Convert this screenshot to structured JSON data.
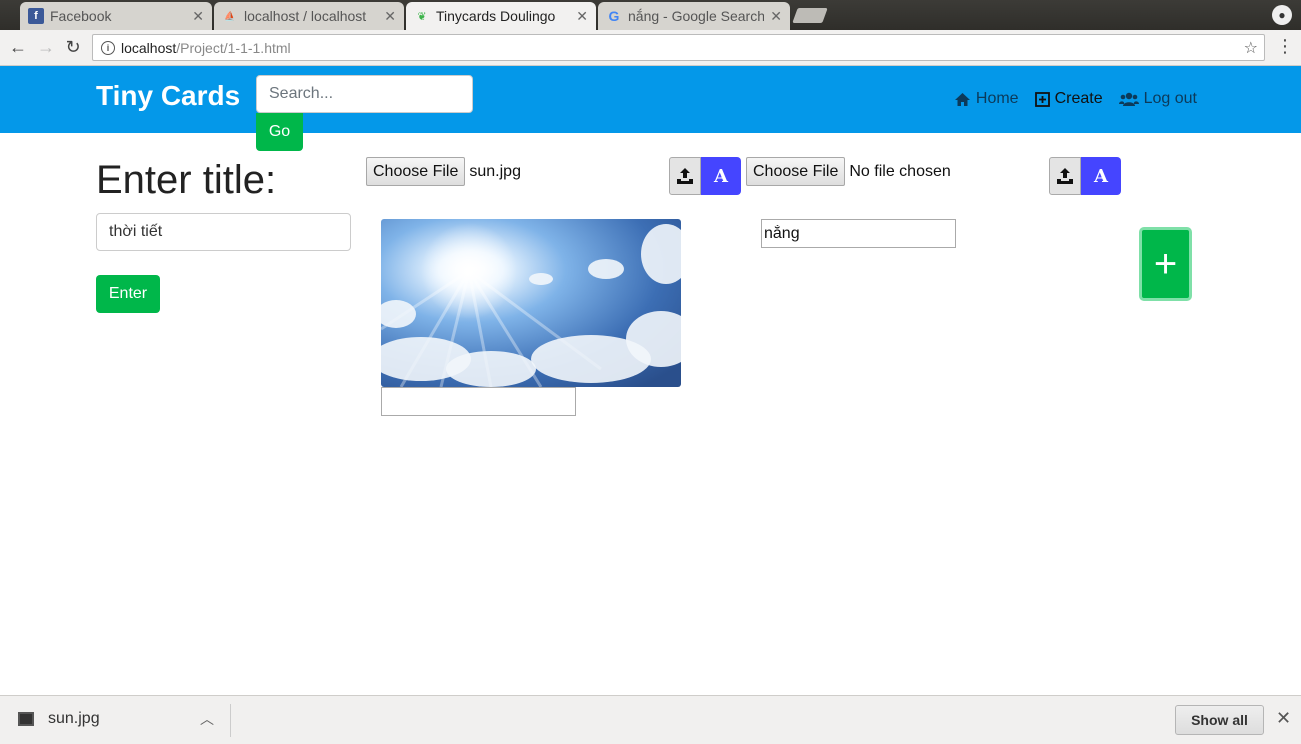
{
  "browser": {
    "tabs": [
      {
        "title": "Facebook",
        "icon": "facebook-icon",
        "active": false
      },
      {
        "title": "localhost / localhost",
        "icon": "phpmyadmin-icon",
        "active": false
      },
      {
        "title": "Tinycards Doulingo",
        "icon": "tinycards-icon",
        "active": true
      },
      {
        "title": "nắng - Google Search",
        "icon": "google-icon",
        "active": false
      }
    ],
    "url_host": "localhost",
    "url_path": "/Project/1-1-1.html"
  },
  "navbar": {
    "brand": "Tiny Cards",
    "search_placeholder": "Search...",
    "go_label": "Go",
    "links": {
      "home": "Home",
      "create": "Create",
      "logout": "Log out"
    },
    "bg_color": "#0498e9"
  },
  "form": {
    "title_heading": "Enter title:",
    "title_value": "thời tiết",
    "enter_label": "Enter"
  },
  "card1": {
    "choose_file_label": "Choose File",
    "file_name": "sun.jpg",
    "a_button_label": "A",
    "image_alt": "sky with sun",
    "caption_value": ""
  },
  "card2": {
    "choose_file_label": "Choose File",
    "file_name": "No file chosen",
    "a_button_label": "A",
    "caption_value": "nắng"
  },
  "add_button_label": "+",
  "downloads": {
    "file_name": "sun.jpg",
    "show_all_label": "Show all"
  },
  "colors": {
    "accent_green": "#00b74a",
    "accent_blue_button": "#4545ff"
  }
}
